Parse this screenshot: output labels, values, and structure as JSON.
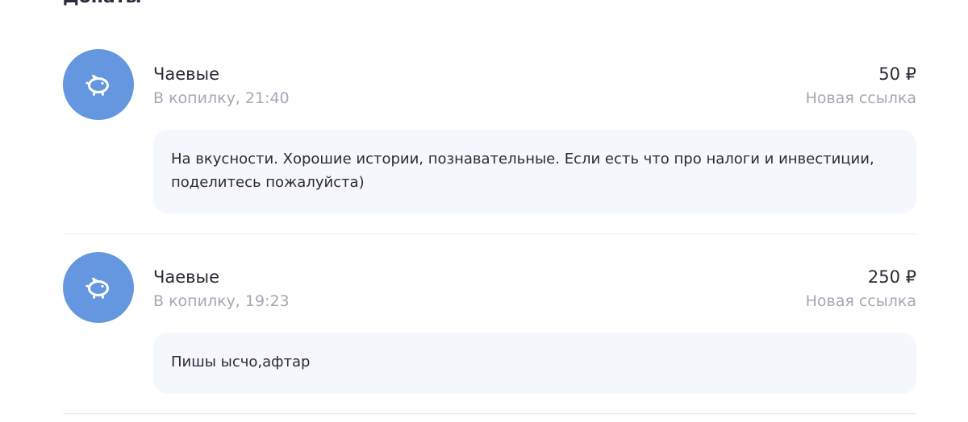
{
  "section": {
    "title": "Донаты"
  },
  "transactions": [
    {
      "icon": "piggy-bank-icon",
      "title": "Чаевые",
      "subtitle": "В копилку, 21:40",
      "amount": "50 ₽",
      "link_label": "Новая ссылка",
      "comment": "На вкусности. Хорошие истории, познавательные. Если есть что про налоги и инвестиции, поделитесь пожалуйста)"
    },
    {
      "icon": "piggy-bank-icon",
      "title": "Чаевые",
      "subtitle": "В копилку, 19:23",
      "amount": "250 ₽",
      "link_label": "Новая ссылка",
      "comment": "Пишы ысчо,афтар"
    }
  ],
  "colors": {
    "avatar_bg": "#6497df",
    "comment_bg": "#f4f7fc",
    "muted_text": "#a4a8b3",
    "primary_text": "#2a2b38",
    "divider": "#e8eaef"
  }
}
